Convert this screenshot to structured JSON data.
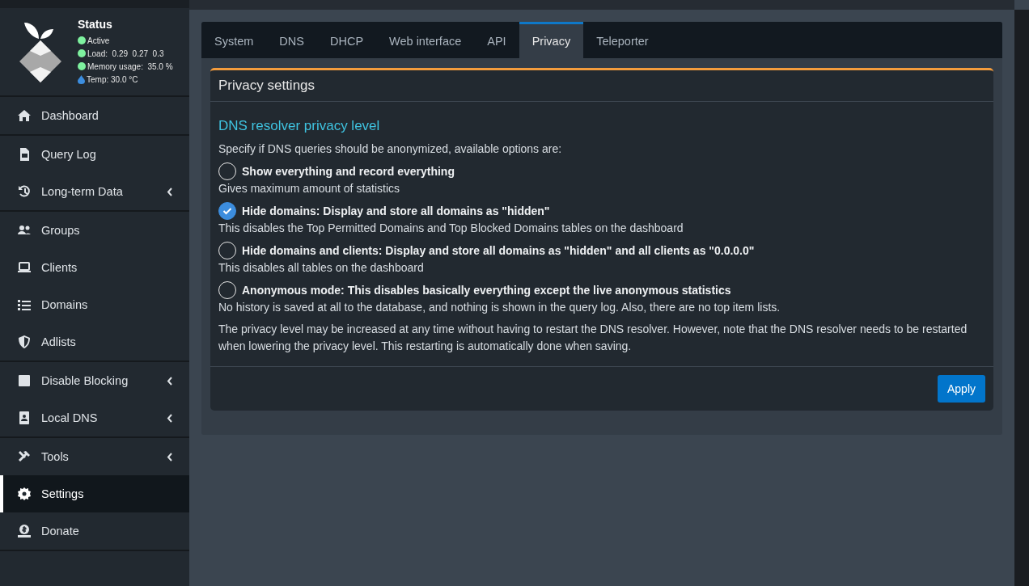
{
  "sidebar": {
    "status": {
      "title": "Status",
      "items": [
        {
          "kind": "dot",
          "text": "Active",
          "color": "#7ef19f"
        },
        {
          "kind": "dot",
          "text": "Load:  0.29  0.27  0.3",
          "color": "#7ef19f"
        },
        {
          "kind": "dot",
          "text": "Memory usage:  35.0 %",
          "color": "#7ef19f"
        },
        {
          "kind": "temp",
          "text": "Temp: 30.0 °C",
          "color": "#3c8dde"
        }
      ]
    },
    "groups": [
      [
        {
          "label": "Dashboard",
          "expandable": false,
          "selected": false
        }
      ],
      [
        {
          "label": "Query Log",
          "expandable": false,
          "selected": false
        },
        {
          "label": "Long-term Data",
          "expandable": true,
          "selected": false
        }
      ],
      [
        {
          "label": "Groups",
          "expandable": false,
          "selected": false
        },
        {
          "label": "Clients",
          "expandable": false,
          "selected": false
        },
        {
          "label": "Domains",
          "expandable": false,
          "selected": false
        },
        {
          "label": "Adlists",
          "expandable": false,
          "selected": false
        }
      ],
      [
        {
          "label": "Disable Blocking",
          "expandable": true,
          "selected": false
        },
        {
          "label": "Local DNS",
          "expandable": true,
          "selected": false
        }
      ],
      [
        {
          "label": "Tools",
          "expandable": true,
          "selected": false
        },
        {
          "label": "Settings",
          "expandable": false,
          "selected": true
        },
        {
          "label": "Donate",
          "expandable": false,
          "selected": false
        }
      ]
    ]
  },
  "tabs": [
    {
      "label": "System",
      "selected": false
    },
    {
      "label": "DNS",
      "selected": false
    },
    {
      "label": "DHCP",
      "selected": false
    },
    {
      "label": "Web interface",
      "selected": false
    },
    {
      "label": "API",
      "selected": false
    },
    {
      "label": "Privacy",
      "selected": true
    },
    {
      "label": "Teleporter",
      "selected": false
    }
  ],
  "card": {
    "title": "Privacy settings",
    "section_title": "DNS resolver privacy level",
    "intro": "Specify if DNS queries should be anonymized, available options are:",
    "options": [
      {
        "label": "Show everything and record everything",
        "description": "Gives maximum amount of statistics",
        "selected": false
      },
      {
        "label": "Hide domains: Display and store all domains as \"hidden\"",
        "description": "This disables the Top Permitted Domains and Top Blocked Domains tables on the dashboard",
        "selected": true
      },
      {
        "label": "Hide domains and clients: Display and store all domains as \"hidden\" and all clients as \"0.0.0.0\"",
        "description": "This disables all tables on the dashboard",
        "selected": false
      },
      {
        "label": "Anonymous mode: This disables basically everything except the live anonymous statistics",
        "description": "No history is saved at all to the database, and nothing is shown in the query log. Also, there are no top item lists.",
        "selected": false
      }
    ],
    "note": "The privacy level may be increased at any time without having to restart the DNS resolver. However, note that the DNS resolver needs to be restarted when lowering the privacy level. This restarting is automatically done when saving.",
    "button": "Apply"
  }
}
